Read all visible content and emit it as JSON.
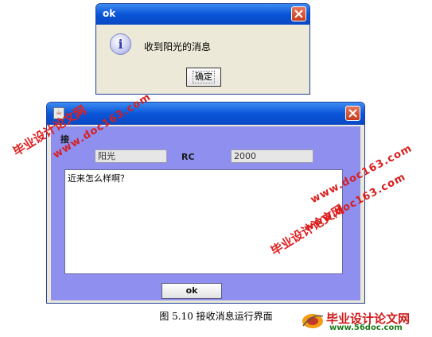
{
  "dialog_top": {
    "title": "ok",
    "message": "收到阳光的消息",
    "confirm_label": "确定"
  },
  "chat_window": {
    "pending_label": "接",
    "sender_value": "阳光",
    "rc_label": "RC",
    "rc_value": "2000",
    "message_text": "近来怎么样啊？",
    "ok_label": "ok"
  },
  "caption": "图 5.10 接收消息运行界面",
  "watermarks": {
    "site_cn": "毕业设计论文网",
    "site_url": "www.doc163.com",
    "logo_url": "www.56doc.com"
  },
  "colors": {
    "titlebar": "#0a55d9",
    "content_bg": "#8f8ff0",
    "watermark": "#e02020"
  }
}
